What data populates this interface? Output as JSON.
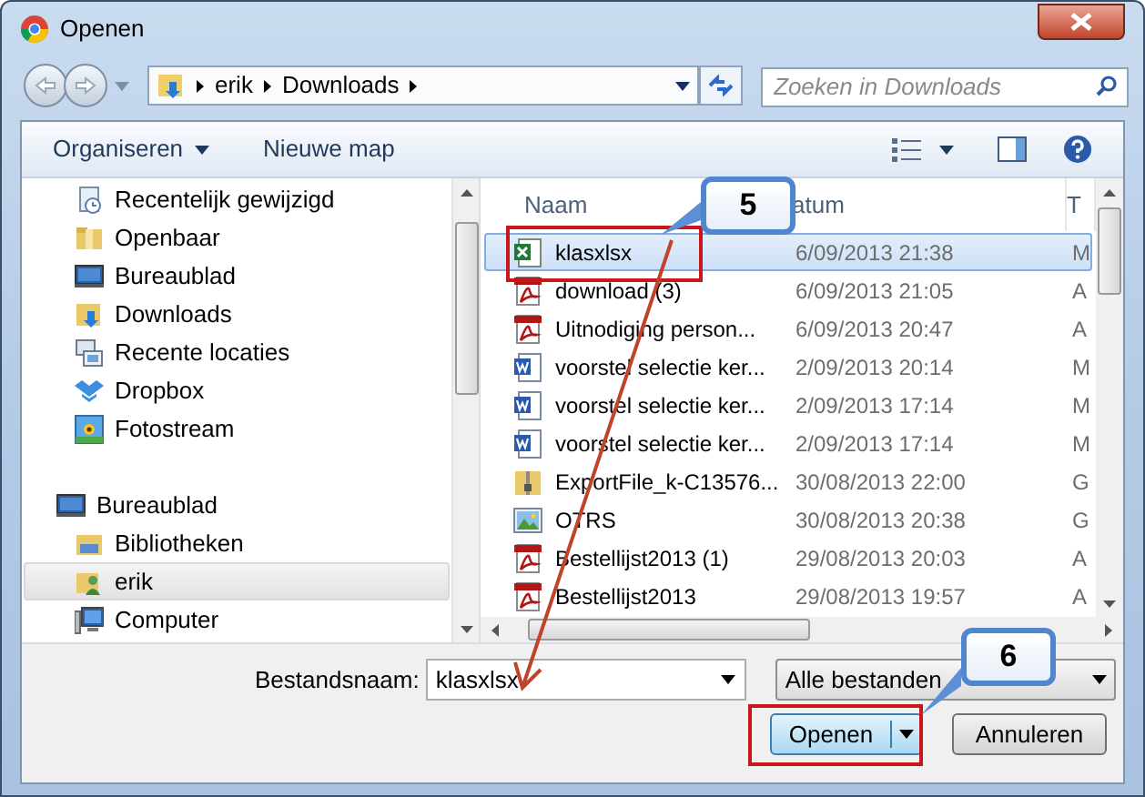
{
  "window": {
    "title": "Openen"
  },
  "address_bar": {
    "crumbs": [
      "erik",
      "Downloads"
    ]
  },
  "search": {
    "placeholder": "Zoeken in Downloads"
  },
  "toolbar": {
    "items": [
      {
        "label": "Organiseren",
        "kind": "menu"
      },
      {
        "label": "Nieuwe map",
        "kind": "plain"
      }
    ]
  },
  "nav_pane": {
    "favorites": [
      {
        "label": "Recentelijk gewijzigd",
        "kind": "recent",
        "selected": false
      },
      {
        "label": "Openbaar",
        "kind": "folder",
        "selected": false
      },
      {
        "label": "Bureaublad",
        "kind": "desktop",
        "selected": false
      },
      {
        "label": "Downloads",
        "kind": "downloads",
        "selected": false
      },
      {
        "label": "Recente locaties",
        "kind": "places",
        "selected": false
      },
      {
        "label": "Dropbox",
        "kind": "box",
        "selected": false
      },
      {
        "label": "Fotostream",
        "kind": "photo",
        "selected": false
      }
    ],
    "tree": [
      {
        "label": "Bureaublad",
        "kind": "desktop",
        "selected": false,
        "children": [
          {
            "label": "Bibliotheken",
            "kind": "library",
            "selected": false
          },
          {
            "label": "erik",
            "kind": "user",
            "selected": true
          },
          {
            "label": "Computer",
            "kind": "computer",
            "selected": false
          }
        ]
      }
    ]
  },
  "file_list": {
    "columns": [
      "Naam",
      "atum",
      "T"
    ],
    "rows": [
      {
        "kind": "excel",
        "name": "klasxlsx",
        "date": "6/09/2013 21:38",
        "column_3": "M",
        "selected": true
      },
      {
        "kind": "pdf",
        "name": "download (3)",
        "date": "6/09/2013 21:05",
        "column_3": "A",
        "selected": false
      },
      {
        "kind": "pdf",
        "name": "Uitnodiging person...",
        "date": "6/09/2013 20:47",
        "column_3": "A",
        "selected": false
      },
      {
        "kind": "word",
        "name": "voorstel selectie ker...",
        "date": "2/09/2013 20:14",
        "column_3": "M",
        "selected": false
      },
      {
        "kind": "word",
        "name": "voorstel selectie ker...",
        "date": "2/09/2013 17:14",
        "column_3": "M",
        "selected": false
      },
      {
        "kind": "word",
        "name": "voorstel selectie ker...",
        "date": "2/09/2013 17:14",
        "column_3": "M",
        "selected": false
      },
      {
        "kind": "zip",
        "name": "ExportFile_k-C13576...",
        "date": "30/08/2013 22:00",
        "column_3": "G",
        "selected": false
      },
      {
        "kind": "image",
        "name": "OTRS",
        "date": "30/08/2013 20:38",
        "column_3": "G",
        "selected": false
      },
      {
        "kind": "pdf",
        "name": "Bestellijst2013 (1)",
        "date": "29/08/2013 20:03",
        "column_3": "A",
        "selected": false
      },
      {
        "kind": "pdf",
        "name": "Bestellijst2013",
        "date": "29/08/2013 19:57",
        "column_3": "A",
        "selected": false
      }
    ]
  },
  "file_name": {
    "label": "Bestandsnaam:",
    "value": "klasxlsx"
  },
  "file_type": {
    "value": "Alle bestanden"
  },
  "buttons": [
    {
      "label": "Openen",
      "kind": "split"
    },
    {
      "label": "Annuleren",
      "kind": "plain"
    }
  ],
  "annotations": [
    {
      "label": "5"
    },
    {
      "label": "6"
    }
  ]
}
